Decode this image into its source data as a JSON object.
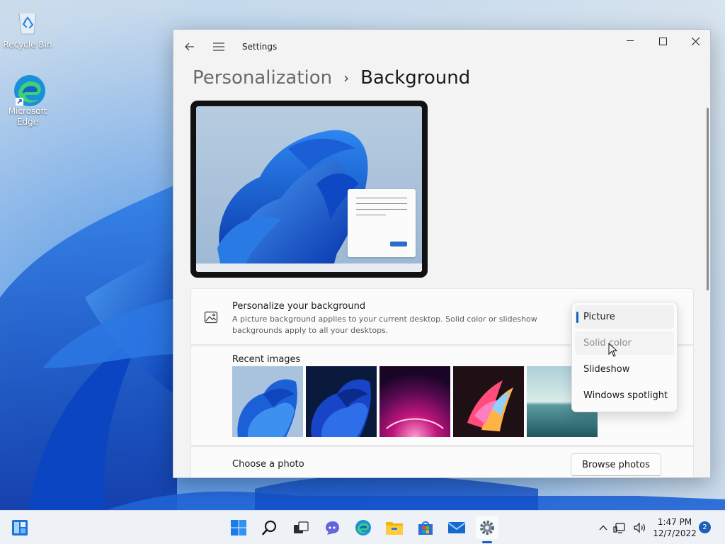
{
  "desktop": {
    "icons": [
      {
        "label": "Recycle Bin"
      },
      {
        "label": "Microsoft Edge"
      }
    ]
  },
  "window": {
    "app_title": "Settings",
    "breadcrumb": {
      "parent": "Personalization",
      "separator": "›",
      "current": "Background"
    },
    "personalize": {
      "title": "Personalize your background",
      "description": "A picture background applies to your current desktop. Solid color or slideshow backgrounds apply to all your desktops."
    },
    "recent_images_label": "Recent images",
    "choose_photo_label": "Choose a photo",
    "browse_button": "Browse photos",
    "dropdown": {
      "options": [
        "Picture",
        "Solid color",
        "Slideshow",
        "Windows spotlight"
      ],
      "selected": "Picture",
      "hovered": "Solid color"
    }
  },
  "taskbar": {
    "time": "1:47 PM",
    "date": "12/7/2022",
    "notification_count": "2"
  },
  "colors": {
    "accent": "#1c5fb8",
    "window_bg": "#f3f3f3",
    "card_bg": "#fbfbfb"
  }
}
